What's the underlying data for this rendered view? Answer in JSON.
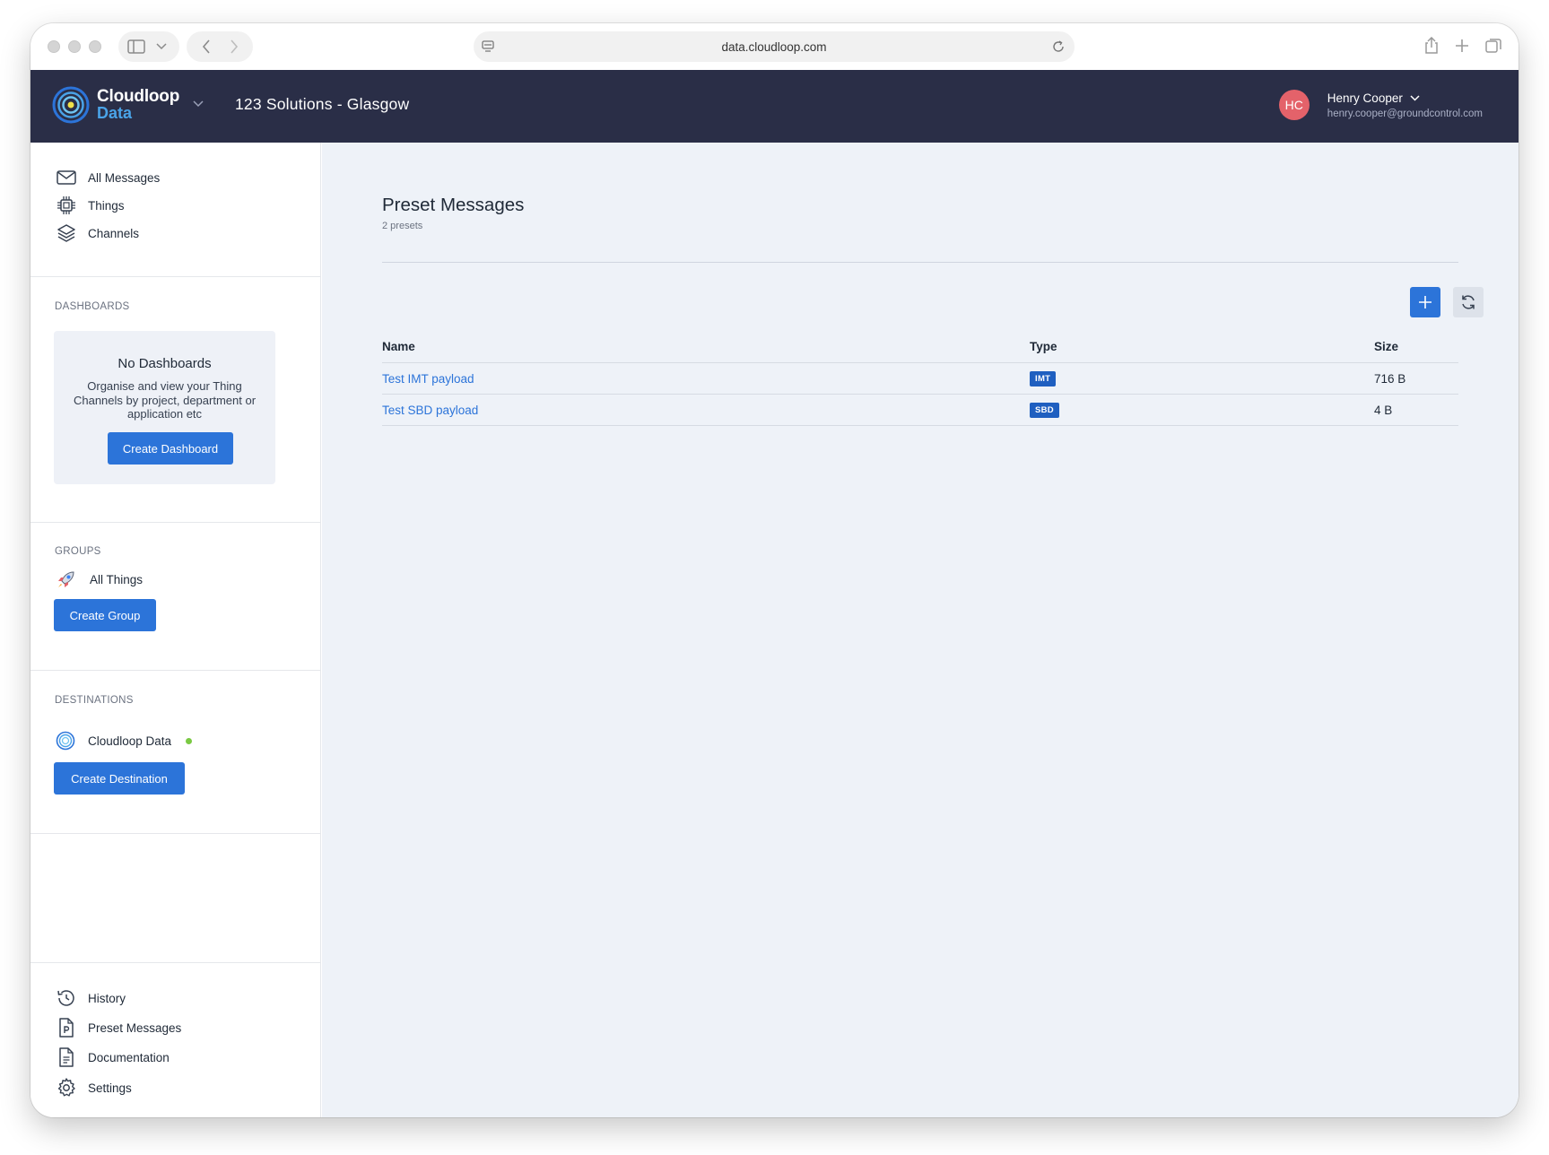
{
  "browser": {
    "url": "data.cloudloop.com"
  },
  "header": {
    "brand": "Cloudloop",
    "brand_sub": "Data",
    "org_name": "123 Solutions - Glasgow",
    "user": {
      "initials": "HC",
      "name": "Henry Cooper",
      "email": "henry.cooper@groundcontrol.com",
      "avatar_color": "#e4626a"
    }
  },
  "sidebar": {
    "top_nav": [
      {
        "label": "All Messages",
        "icon": "envelope-icon"
      },
      {
        "label": "Things",
        "icon": "chip-icon"
      },
      {
        "label": "Channels",
        "icon": "layers-icon"
      }
    ],
    "dashboards": {
      "title": "DASHBOARDS",
      "empty_title": "No Dashboards",
      "empty_text": "Organise and view your Thing Channels by project, department or application etc",
      "create_label": "Create Dashboard"
    },
    "groups": {
      "title": "GROUPS",
      "items": [
        {
          "label": "All Things",
          "icon": "rocket-icon"
        }
      ],
      "create_label": "Create Group"
    },
    "destinations": {
      "title": "DESTINATIONS",
      "items": [
        {
          "label": "Cloudloop Data",
          "icon": "cloudloop-icon",
          "status": "active",
          "status_color": "#7ac943"
        }
      ],
      "create_label": "Create Destination"
    },
    "bottom_nav": [
      {
        "label": "History",
        "icon": "history-icon"
      },
      {
        "label": "Preset Messages",
        "icon": "preset-document-icon"
      },
      {
        "label": "Documentation",
        "icon": "document-icon"
      },
      {
        "label": "Settings",
        "icon": "gear-icon"
      }
    ]
  },
  "main": {
    "title": "Preset Messages",
    "subtitle": "2 presets",
    "table": {
      "columns": [
        "Name",
        "Type",
        "Size"
      ],
      "rows": [
        {
          "name": "Test IMT payload",
          "type": "IMT",
          "size": "716 B"
        },
        {
          "name": "Test SBD payload",
          "type": "SBD",
          "size": "4 B"
        }
      ]
    }
  },
  "colors": {
    "header_bg": "#2a2e47",
    "primary": "#2c74d9",
    "main_bg": "#eef2f8"
  }
}
